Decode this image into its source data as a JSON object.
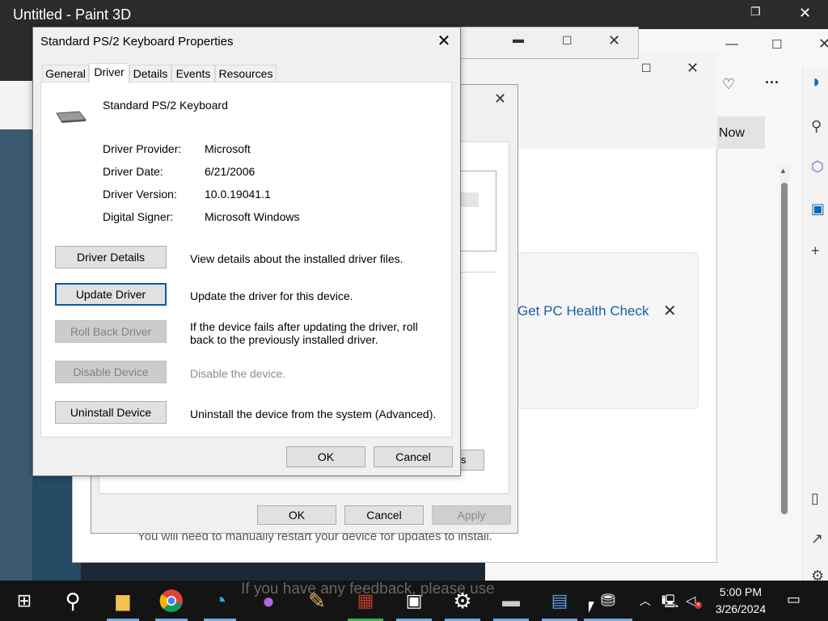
{
  "background": {
    "paint": {
      "title": "Untitled - Paint 3D"
    },
    "edge": {
      "buy_now": "t Now"
    },
    "update": {
      "health_link": "Get PC Health Check",
      "restart_note": "You will need to manually restart your device for updates to install.",
      "share_note": "If you have any feedback, please use"
    },
    "device_dialog": {
      "ok": "OK",
      "cancel": "Cancel",
      "apply": "Apply",
      "partial_button": "s"
    }
  },
  "dialog": {
    "title": "Standard PS/2 Keyboard Properties",
    "tabs": [
      "General",
      "Driver",
      "Details",
      "Events",
      "Resources"
    ],
    "active_tab": "Driver",
    "device_name": "Standard PS/2 Keyboard",
    "info": [
      {
        "label": "Driver Provider:",
        "value": "Microsoft"
      },
      {
        "label": "Driver Date:",
        "value": "6/21/2006"
      },
      {
        "label": "Driver Version:",
        "value": "10.0.19041.1"
      },
      {
        "label": "Digital Signer:",
        "value": "Microsoft Windows"
      }
    ],
    "actions": [
      {
        "label": "Driver Details",
        "desc": "View details about the installed driver files.",
        "enabled": true
      },
      {
        "label": "Update Driver",
        "desc": "Update the driver for this device.",
        "enabled": true,
        "focused": true
      },
      {
        "label": "Roll Back Driver",
        "desc": "If the device fails after updating the driver, roll back to the previously installed driver.",
        "enabled": false
      },
      {
        "label": "Disable Device",
        "desc": "Disable the device.",
        "enabled": false
      },
      {
        "label": "Uninstall Device",
        "desc": "Uninstall the device from the system (Advanced).",
        "enabled": true
      }
    ],
    "ok": "OK",
    "cancel": "Cancel"
  },
  "taskbar": {
    "apps": [
      "start-icon",
      "search-icon",
      "file-explorer-icon",
      "chrome-icon",
      "edge-icon",
      "paint-drop-icon",
      "paint-palette-icon",
      "winrar-icon",
      "store-icon",
      "settings-icon",
      "keyboard-icon",
      "device-manager-icon",
      "device-properties-icon"
    ],
    "time": "5:00 PM",
    "date": "3/26/2024"
  },
  "colors": {
    "accent": "#0a5aa5",
    "link": "#1460aa",
    "taskbar": "#141414"
  }
}
